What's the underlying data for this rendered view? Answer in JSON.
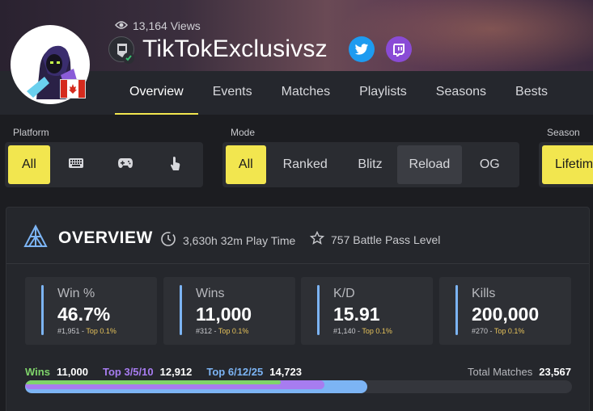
{
  "profile": {
    "views": "13,164 Views",
    "name": "TikTokExclusivsz",
    "flag": "canada-flag"
  },
  "tabs": [
    "Overview",
    "Events",
    "Matches",
    "Playlists",
    "Seasons",
    "Bests"
  ],
  "filters": {
    "platform": {
      "label": "Platform",
      "all": "All",
      "icons": [
        "keyboard-icon",
        "gamepad-icon",
        "touch-icon"
      ]
    },
    "mode": {
      "label": "Mode",
      "options": [
        "All",
        "Ranked",
        "Blitz",
        "Reload",
        "OG"
      ]
    },
    "season": {
      "label": "Season",
      "selected": "Lifetim"
    }
  },
  "overview": {
    "title": "OVERVIEW",
    "play_time": "3,630h 32m Play Time",
    "battle_pass": "757 Battle Pass Level"
  },
  "stats": [
    {
      "label": "Win %",
      "value": "46.7%",
      "rank": "#1,951",
      "top": "Top 0.1%"
    },
    {
      "label": "Wins",
      "value": "11,000",
      "rank": "#312",
      "top": "Top 0.1%"
    },
    {
      "label": "K/D",
      "value": "15.91",
      "rank": "#1,140",
      "top": "Top 0.1%"
    },
    {
      "label": "Kills",
      "value": "200,000",
      "rank": "#270",
      "top": "Top 0.1%"
    }
  ],
  "progress": {
    "wins_label": "Wins",
    "wins_value": "11,000",
    "top3_label": "Top 3/5/10",
    "top3_value": "12,912",
    "top6_label": "Top 6/12/25",
    "top6_value": "14,723",
    "total_label": "Total Matches",
    "total_value": "23,567",
    "wins_fraction": 0.467,
    "top3_fraction": 0.548,
    "top6_fraction": 0.625
  },
  "colors": {
    "accent": "#f2e64f",
    "wins": "#7fd46a",
    "top3": "#a77cf0",
    "top6": "#7cb4f4"
  }
}
